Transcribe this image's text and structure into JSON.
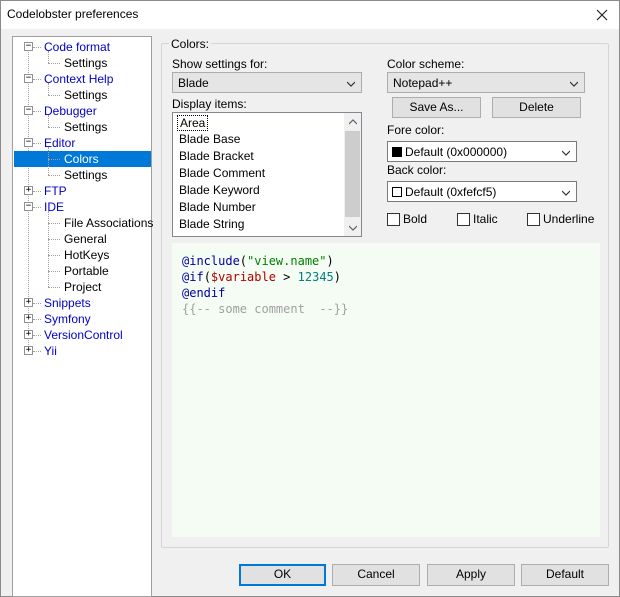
{
  "window": {
    "title": "Codelobster preferences"
  },
  "tree": {
    "rows": [
      {
        "label": "Code format",
        "type": "parent",
        "expanded": true
      },
      {
        "label": "Settings",
        "type": "child"
      },
      {
        "label": "Context Help",
        "type": "parent",
        "expanded": true
      },
      {
        "label": "Settings",
        "type": "child"
      },
      {
        "label": "Debugger",
        "type": "parent",
        "expanded": true
      },
      {
        "label": "Settings",
        "type": "child"
      },
      {
        "label": "Editor",
        "type": "parent",
        "expanded": true
      },
      {
        "label": "Colors",
        "type": "child",
        "selected": true
      },
      {
        "label": "Settings",
        "type": "child"
      },
      {
        "label": "FTP",
        "type": "parent",
        "expanded": false
      },
      {
        "label": "IDE",
        "type": "parent",
        "expanded": true
      },
      {
        "label": "File Associations",
        "type": "child"
      },
      {
        "label": "General",
        "type": "child"
      },
      {
        "label": "HotKeys",
        "type": "child"
      },
      {
        "label": "Portable",
        "type": "child"
      },
      {
        "label": "Project",
        "type": "child"
      },
      {
        "label": "Snippets",
        "type": "parent",
        "expanded": false
      },
      {
        "label": "Symfony",
        "type": "parent",
        "expanded": false
      },
      {
        "label": "VersionControl",
        "type": "parent",
        "expanded": false
      },
      {
        "label": "Yii",
        "type": "parent",
        "expanded": false
      }
    ]
  },
  "colors": {
    "group_title": "Colors:",
    "show_settings_label": "Show settings for:",
    "show_settings_value": "Blade",
    "display_items_label": "Display items:",
    "display_items": [
      "Area",
      "Blade Base",
      "Blade Bracket",
      "Blade Comment",
      "Blade Keyword",
      "Blade Number",
      "Blade String"
    ],
    "color_scheme_label": "Color scheme:",
    "color_scheme_value": "Notepad++",
    "save_as_label": "Save As...",
    "delete_label": "Delete",
    "fore_color_label": "Fore color:",
    "fore_color_value": "Default (0x000000)",
    "fore_color_swatch": "#000000",
    "back_color_label": "Back color:",
    "back_color_value": "Default (0xfefcf5)",
    "back_color_swatch": "#ffffff",
    "bold_label": "Bold",
    "italic_label": "Italic",
    "underline_label": "Underline"
  },
  "preview": {
    "line1": {
      "kw": "@include",
      "open": "(",
      "str": "\"view.name\"",
      "close": ")"
    },
    "line2": {
      "kw": "@if",
      "open": "(",
      "var": "$variable",
      "op": " > ",
      "num": "12345",
      "close": ")"
    },
    "line3": {
      "kw": "@endif"
    },
    "line4": {
      "cmt": "{{-- some comment  --}}"
    }
  },
  "buttons": {
    "ok": "OK",
    "cancel": "Cancel",
    "apply": "Apply",
    "default": "Default"
  }
}
